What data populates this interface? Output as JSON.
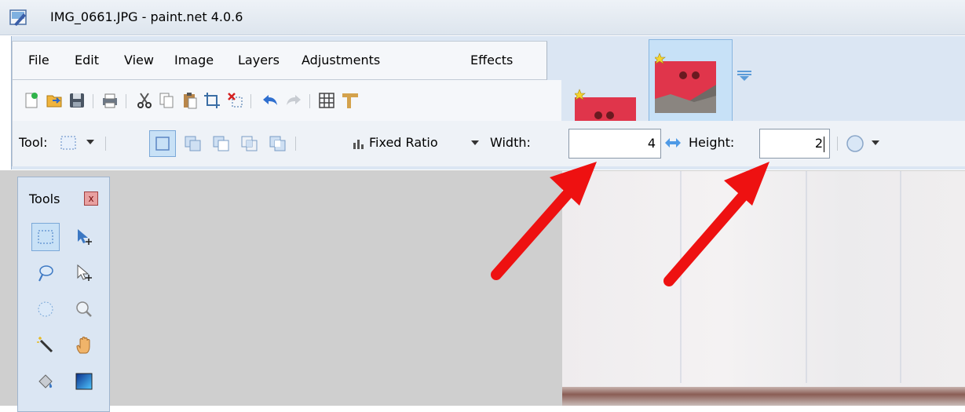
{
  "window": {
    "title": "IMG_0661.JPG - paint.net 4.0.6"
  },
  "menu": {
    "items": [
      "File",
      "Edit",
      "View",
      "Image",
      "Layers",
      "Adjustments",
      "Effects"
    ]
  },
  "toolbar": {
    "icons": [
      "new-icon",
      "open-icon",
      "save-icon",
      "print-icon",
      "cut-icon",
      "copy-icon",
      "paste-icon",
      "crop-icon",
      "deselect-icon",
      "undo-icon",
      "redo-icon",
      "grid-icon",
      "ruler-icon"
    ]
  },
  "options": {
    "tool_label": "Tool:",
    "ratio_mode": "Fixed Ratio",
    "width_label": "Width:",
    "width_value": "4",
    "height_label": "Height:",
    "height_value": "2"
  },
  "tools_panel": {
    "title": "Tools",
    "close": "x"
  },
  "colors": {
    "accent": "#3c78c3",
    "arrow": "#ee1111"
  }
}
